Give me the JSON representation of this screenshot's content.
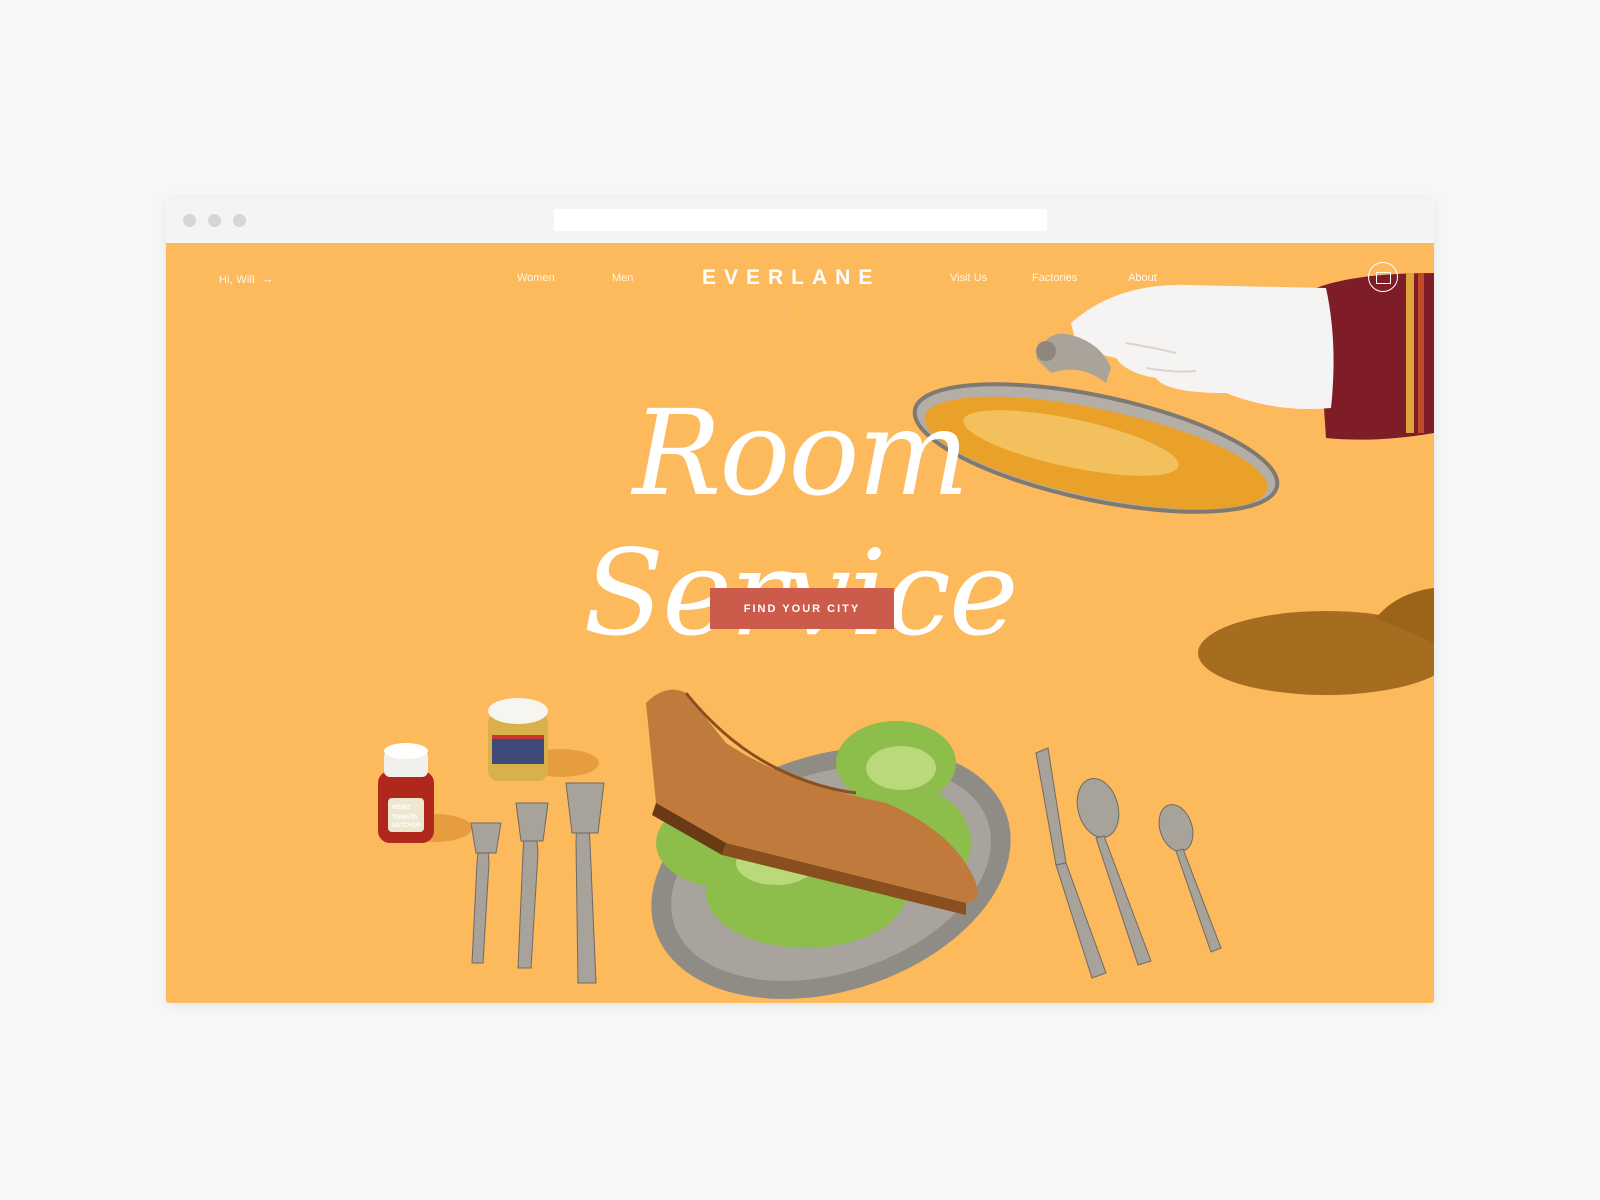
{
  "nav": {
    "greeting": "Hi, Will",
    "greeting_arrow": "→",
    "links": [
      "Women",
      "Men",
      "Visit Us",
      "Factories",
      "About"
    ],
    "logo": "EVERLANE"
  },
  "hero": {
    "headline": "Room Service",
    "cta_label": "FIND YOUR CITY"
  },
  "product_labels": {
    "ketchup_brand": "HEINZ",
    "ketchup_line1": "TOMATO",
    "ketchup_line2": "KETCHUP"
  },
  "colors": {
    "background": "#fcba5c",
    "cta": "#cd5b4c",
    "page": "#f7f7f7"
  },
  "icons": [
    "arrow-right-icon",
    "shopping-bag-icon"
  ]
}
